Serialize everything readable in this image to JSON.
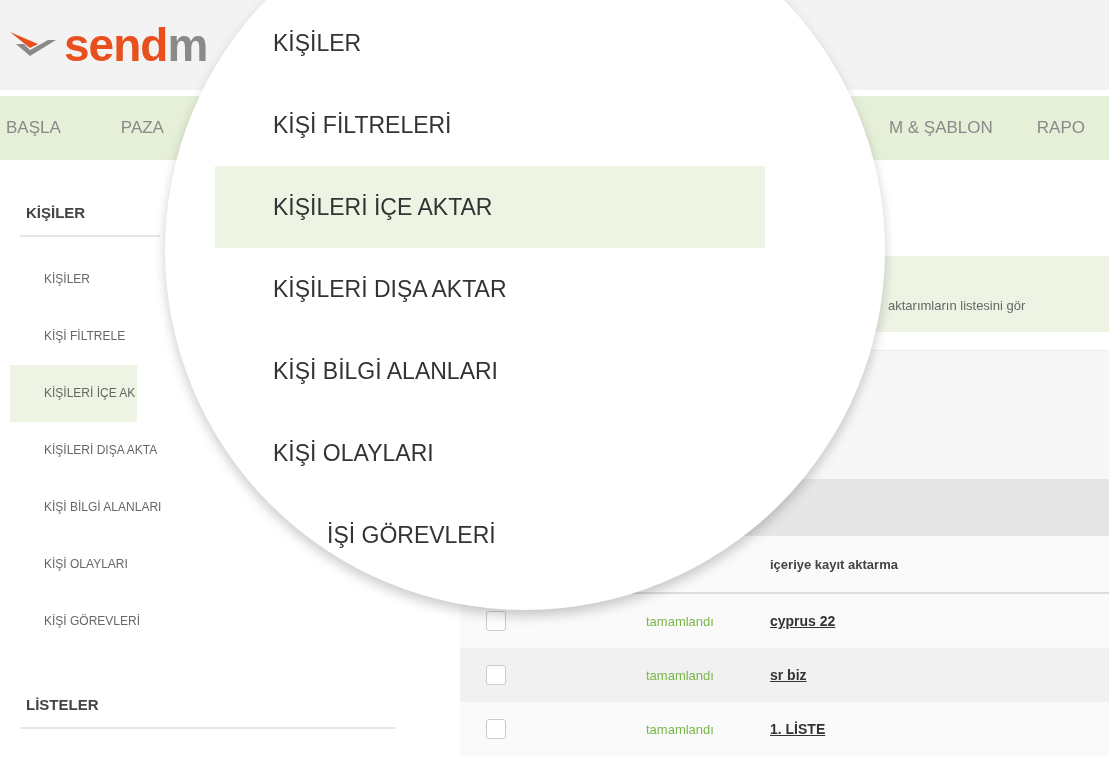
{
  "logo": {
    "text": "send",
    "text_cut": "m"
  },
  "nav": [
    {
      "label": "BAŞLA"
    },
    {
      "label": "PAZA"
    },
    {
      "label": "M & ŞABLON"
    },
    {
      "label": "RAPO"
    }
  ],
  "sidebar": {
    "sections": [
      {
        "title": "KİŞİLER",
        "items": [
          {
            "label": "KİŞİLER",
            "selected": false
          },
          {
            "label": "KİŞİ FİLTRELE",
            "selected": false
          },
          {
            "label": "KİŞİLERİ İÇE AK",
            "selected": true
          },
          {
            "label": "KİŞİLERİ DIŞA AKTA",
            "selected": false
          },
          {
            "label": "KİŞİ BİLGİ ALANLARI",
            "selected": false
          },
          {
            "label": "KİŞİ OLAYLARI",
            "selected": false
          },
          {
            "label": "KİŞİ GÖREVLERİ",
            "selected": false
          }
        ]
      },
      {
        "title": "LİSTELER"
      }
    ]
  },
  "notice": {
    "text": "aktarımların listesini gör"
  },
  "table": {
    "header": "içeriye kayıt aktarma",
    "rows": [
      {
        "checked": false,
        "status": "tamamlandı",
        "name": "cyprus 22"
      },
      {
        "checked": false,
        "status": "tamamlandı",
        "name": "sr biz"
      },
      {
        "checked": false,
        "status": "tamamlandı",
        "name": "1. LİSTE"
      }
    ]
  },
  "magnifier": {
    "items": [
      {
        "label": "KİŞİLER",
        "selected": false
      },
      {
        "label": "KİŞİ FİLTRELERİ",
        "selected": false
      },
      {
        "label": "KİŞİLERİ İÇE AKTAR",
        "selected": true
      },
      {
        "label": "KİŞİLERİ DIŞA AKTAR",
        "selected": false
      },
      {
        "label": "KİŞİ BİLGİ ALANLARI",
        "selected": false
      },
      {
        "label": "KİŞİ OLAYLARI",
        "selected": false
      },
      {
        "label": "İŞİ GÖREVLERİ",
        "selected": false
      }
    ]
  }
}
